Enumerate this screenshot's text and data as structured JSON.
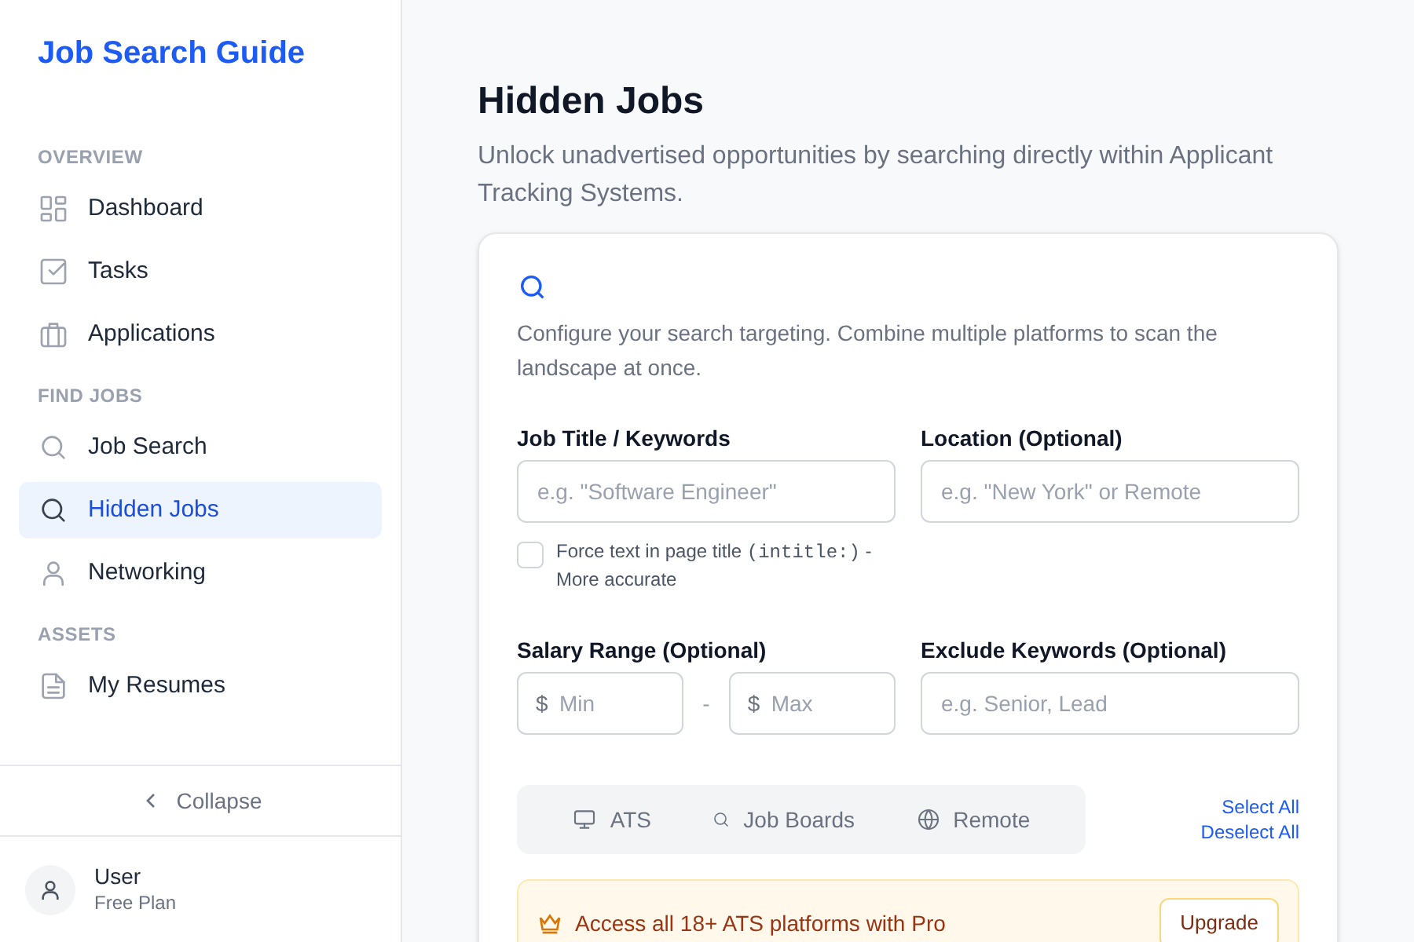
{
  "sidebar": {
    "brand": "Job Search Guide",
    "sections": [
      {
        "heading": "OVERVIEW",
        "items": [
          {
            "label": "Dashboard",
            "kind": "grid",
            "selected": false
          },
          {
            "label": "Tasks",
            "kind": "check",
            "selected": false
          },
          {
            "label": "Applications",
            "kind": "briefcase",
            "selected": false
          }
        ]
      },
      {
        "heading": "FIND JOBS",
        "items": [
          {
            "label": "Job Search",
            "kind": "search",
            "selected": false
          },
          {
            "label": "Hidden Jobs",
            "kind": "search",
            "selected": true
          },
          {
            "label": "Networking",
            "kind": "user",
            "selected": false
          }
        ]
      },
      {
        "heading": "ASSETS",
        "items": [
          {
            "label": "My Resumes",
            "kind": "file",
            "selected": false
          }
        ]
      }
    ],
    "collapse": "Collapse",
    "user": {
      "name": "User",
      "plan": "Free Plan"
    }
  },
  "page": {
    "title": "Hidden Jobs",
    "subtitle": "Unlock unadvertised opportunities by searching directly within Applicant Tracking Systems."
  },
  "card": {
    "intro": "Configure your search targeting. Combine multiple platforms to scan the landscape at once.",
    "job_title": {
      "label": "Job Title / Keywords",
      "placeholder": "e.g. \"Software Engineer\""
    },
    "location": {
      "label": "Location (Optional)",
      "placeholder": "e.g. \"New York\" or Remote"
    },
    "intitle": {
      "text": "Force text in page title",
      "code": "(intitle:)",
      "suffix": "- More accurate",
      "checked": false
    },
    "salary": {
      "label": "Salary Range (Optional)",
      "min_placeholder": "Min",
      "max_placeholder": "Max",
      "currency": "$",
      "separator": "-"
    },
    "exclude": {
      "label": "Exclude Keywords (Optional)",
      "placeholder": "e.g. Senior, Lead"
    },
    "tabs": [
      {
        "label": "ATS",
        "kind": "monitor",
        "selected": false
      },
      {
        "label": "Job Boards",
        "kind": "search",
        "selected": false
      },
      {
        "label": "Remote",
        "kind": "globe",
        "selected": false
      }
    ],
    "select_all": "Select All",
    "deselect_all": "Deselect All",
    "promo": {
      "text": "Access all 18+ ATS platforms with Pro",
      "button": "Upgrade"
    }
  }
}
